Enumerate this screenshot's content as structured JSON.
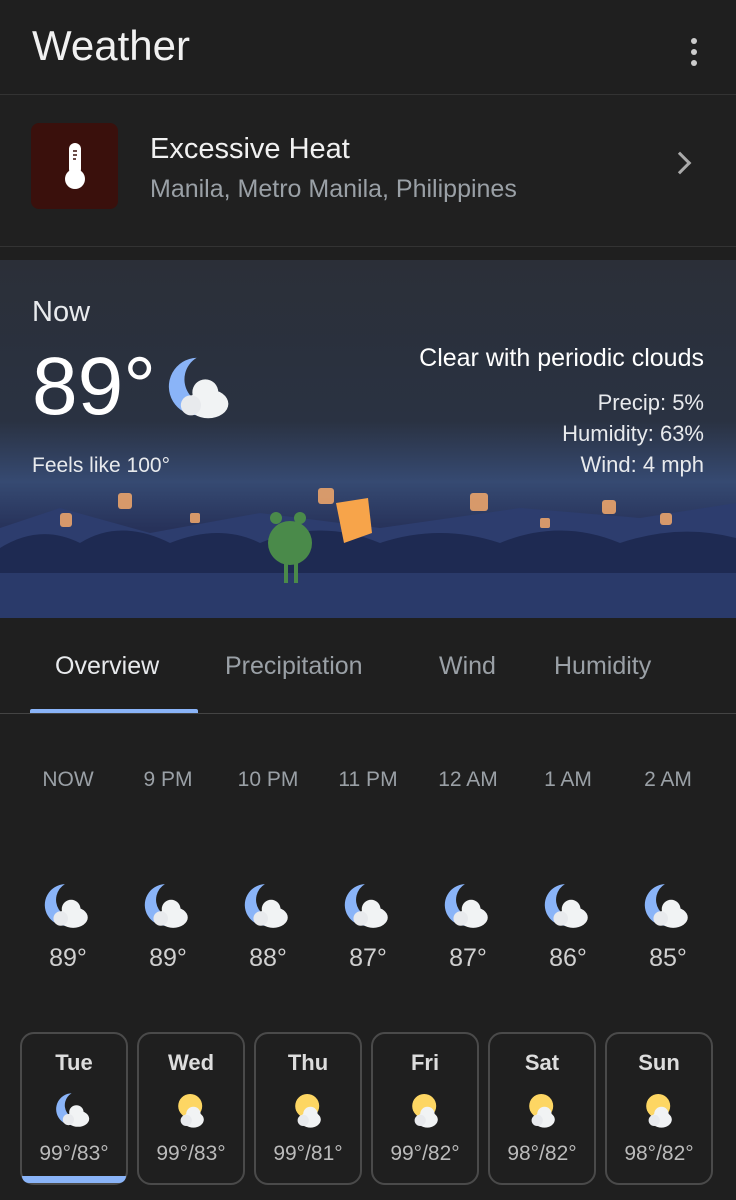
{
  "header": {
    "title": "Weather",
    "menu_icon": "more-vert-icon"
  },
  "alert": {
    "title": "Excessive Heat",
    "location": "Manila, Metro Manila, Philippines",
    "icon": "thermometer-icon",
    "icon_bg": "#3a100c"
  },
  "current": {
    "label": "Now",
    "temperature": "89°",
    "feels_like": "Feels like 100°",
    "condition": "Clear with periodic clouds",
    "precip": "Precip: 5%",
    "humidity": "Humidity: 63%",
    "wind": "Wind: 4 mph",
    "icon": "moon-cloud-icon"
  },
  "tabs": [
    {
      "label": "Overview",
      "active": true
    },
    {
      "label": "Precipitation"
    },
    {
      "label": "Wind"
    },
    {
      "label": "Humidity"
    }
  ],
  "accent": "#8ab4f8",
  "hourly": [
    {
      "time": "NOW",
      "temp": "89°",
      "icon": "moon-cloud-icon"
    },
    {
      "time": "9 PM",
      "temp": "89°",
      "icon": "moon-cloud-icon"
    },
    {
      "time": "10 PM",
      "temp": "88°",
      "icon": "moon-cloud-icon"
    },
    {
      "time": "11 PM",
      "temp": "87°",
      "icon": "moon-cloud-icon"
    },
    {
      "time": "12 AM",
      "temp": "87°",
      "icon": "moon-cloud-icon"
    },
    {
      "time": "1 AM",
      "temp": "86°",
      "icon": "moon-cloud-icon"
    },
    {
      "time": "2 AM",
      "temp": "85°",
      "icon": "moon-cloud-icon"
    }
  ],
  "daily": [
    {
      "day": "Tue",
      "range": "99°/83°",
      "icon": "moon-cloud-icon",
      "selected": true
    },
    {
      "day": "Wed",
      "range": "99°/83°",
      "icon": "sun-cloud-icon"
    },
    {
      "day": "Thu",
      "range": "99°/81°",
      "icon": "sun-cloud-icon"
    },
    {
      "day": "Fri",
      "range": "99°/82°",
      "icon": "sun-cloud-icon"
    },
    {
      "day": "Sat",
      "range": "98°/82°",
      "icon": "sun-cloud-icon"
    },
    {
      "day": "Sun",
      "range": "98°/82°",
      "icon": "sun-cloud-icon"
    }
  ]
}
